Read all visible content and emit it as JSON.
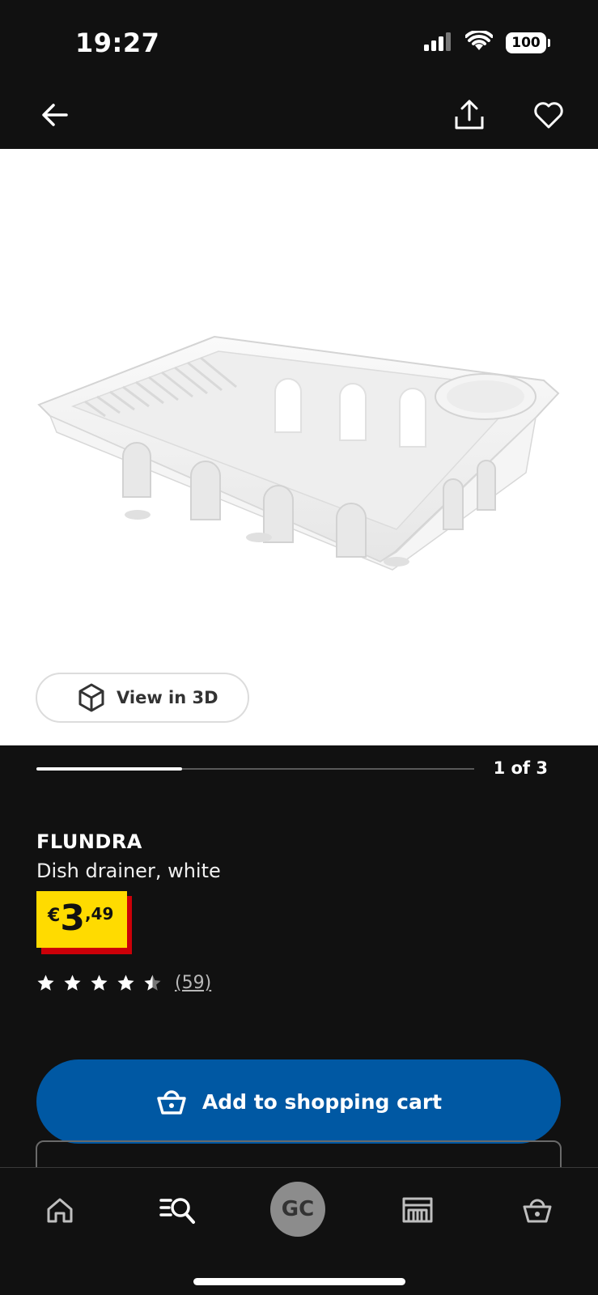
{
  "status_bar": {
    "time": "19:27",
    "battery": "100",
    "icons": [
      "signal-icon",
      "wifi-icon",
      "battery-icon"
    ]
  },
  "top_nav": {
    "icons": [
      "back-arrow-icon",
      "share-icon",
      "heart-icon"
    ]
  },
  "product_image": {
    "view_3d_label": "View in 3D"
  },
  "pager": {
    "label": "1 of 3",
    "current": 1,
    "total": 3
  },
  "product": {
    "name": "FLUNDRA",
    "description": "Dish drainer, white",
    "price": {
      "currency": "€",
      "integer": "3",
      "decimal": ",49"
    },
    "rating": {
      "stars": 4.5,
      "max": 5,
      "review_count": "(59)"
    }
  },
  "actions": {
    "add_to_cart_label": "Add to shopping cart"
  },
  "tab_bar": {
    "items": [
      "home-icon",
      "search-icon",
      "profile-avatar",
      "store-icon",
      "basket-icon"
    ],
    "avatar_initials": "GC"
  },
  "colors": {
    "background": "#111111",
    "accent_blue": "#0058a3",
    "price_yellow": "#ffdb00",
    "price_red": "#cc0008"
  }
}
